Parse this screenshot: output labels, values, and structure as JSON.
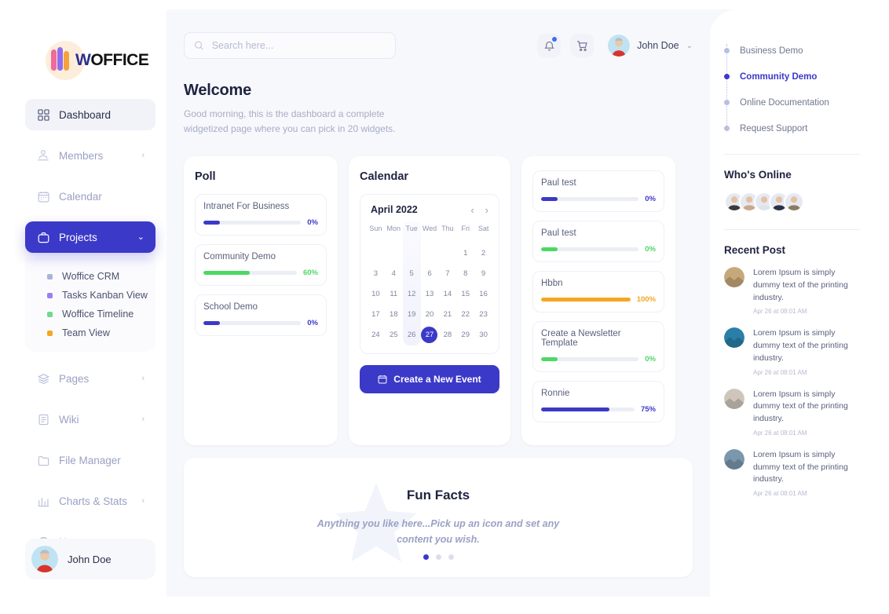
{
  "brand": {
    "name_part1": "W",
    "name_part2": "OFFICE"
  },
  "sidebar": {
    "items": [
      {
        "label": "Dashboard",
        "icon": "grid-icon",
        "state": "active-soft",
        "chevron": ""
      },
      {
        "label": "Members",
        "icon": "members-icon",
        "state": "",
        "chevron": "›"
      },
      {
        "label": "Calendar",
        "icon": "calendar-icon",
        "state": "",
        "chevron": ""
      },
      {
        "label": "Projects",
        "icon": "briefcase-icon",
        "state": "active-primary",
        "chevron": "⌄"
      }
    ],
    "submenu": [
      {
        "label": "Woffice CRM",
        "color": "#a8b4d8"
      },
      {
        "label": "Tasks Kanban View",
        "color": "#9b7ff0"
      },
      {
        "label": "Woffice Timeline",
        "color": "#72d88f"
      },
      {
        "label": "Team View",
        "color": "#f5a623"
      }
    ],
    "items_after": [
      {
        "label": "Pages",
        "icon": "layers-icon",
        "state": "",
        "chevron": "›"
      },
      {
        "label": "Wiki",
        "icon": "book-icon",
        "state": "",
        "chevron": "›"
      },
      {
        "label": "File Manager",
        "icon": "folder-icon",
        "state": "",
        "chevron": ""
      },
      {
        "label": "Charts & Stats",
        "icon": "chart-icon",
        "state": "",
        "chevron": "›"
      },
      {
        "label": "News",
        "icon": "globe-icon",
        "state": "",
        "chevron": ""
      }
    ],
    "user": {
      "name": "John Doe"
    }
  },
  "topbar": {
    "search_placeholder": "Search here...",
    "search_value": "",
    "notification_icon": "bell-icon",
    "cart_icon": "cart-icon",
    "user_name": "John Doe",
    "user_chevron": "⌄"
  },
  "welcome": {
    "title": "Welcome",
    "subtitle": "Good morning, this is the dashboard a complete widgetized page where you can pick in 20 widgets."
  },
  "poll": {
    "title": "Poll",
    "items": [
      {
        "label": "Intranet For Business",
        "percent": "0%",
        "fill": 17,
        "color": "#3b39c8"
      },
      {
        "label": "Community Demo",
        "percent": "60%",
        "fill": 50,
        "color": "#4bd964"
      },
      {
        "label": "School Demo",
        "percent": "0%",
        "fill": 17,
        "color": "#3b39c8"
      }
    ]
  },
  "calendar": {
    "title": "Calendar",
    "month": "April 2022",
    "prev_icon": "chevron-left-icon",
    "next_icon": "chevron-right-icon",
    "prev": "‹",
    "next": "›",
    "dow": [
      "Sun",
      "Mon",
      "Tue",
      "Wed",
      "Thu",
      "Fri",
      "Sat"
    ],
    "lead_blanks": 5,
    "days": [
      1,
      2,
      3,
      4,
      5,
      6,
      7,
      8,
      9,
      10,
      11,
      12,
      13,
      14,
      15,
      16,
      17,
      18,
      19,
      20,
      21,
      22,
      23,
      24,
      25,
      26,
      27,
      28,
      29,
      30
    ],
    "selected_day": 27,
    "highlight_column": "Tue",
    "button_label": "Create a New Event",
    "button_icon": "calendar-icon"
  },
  "tasks": {
    "items": [
      {
        "label": "Paul test",
        "percent": "0%",
        "fill": 17,
        "color": "#3b39c8"
      },
      {
        "label": "Paul test",
        "percent": "0%",
        "fill": 17,
        "color": "#4bd964"
      },
      {
        "label": "Hbbn",
        "percent": "100%",
        "fill": 100,
        "color": "#f5a623"
      },
      {
        "label": "Create a Newsletter Template",
        "percent": "0%",
        "fill": 17,
        "color": "#4bd964"
      },
      {
        "label": "Ronnie",
        "percent": "75%",
        "fill": 73,
        "color": "#3b39c8"
      }
    ]
  },
  "funfacts": {
    "title": "Fun Facts",
    "subtitle": "Anything you like here...Pick up an icon and set any content you wish.",
    "dots": [
      true,
      false,
      false
    ]
  },
  "rightpanel": {
    "demos": [
      {
        "label": "Business Demo",
        "active": false
      },
      {
        "label": "Community Demo",
        "active": true
      },
      {
        "label": "Online Documentation",
        "active": false
      },
      {
        "label": "Request Support",
        "active": false
      }
    ],
    "who_online_title": "Who's Online",
    "online_avatars": [
      "#3b3a35",
      "#c9a88b",
      "#dfe4ea",
      "#2b3245",
      "#8c7a62"
    ],
    "recent_post_title": "Recent Post",
    "posts": [
      {
        "text": "Lorem Ipsum is simply dummy text of the printing industry.",
        "time": "Apr 26 at 08:01 AM",
        "color": "#c6a87a"
      },
      {
        "text": "Lorem Ipsum is simply dummy text of the printing industry.",
        "time": "Apr 26 at 08:01 AM",
        "color": "#2a7fa8"
      },
      {
        "text": "Lorem Ipsum is simply dummy text of the printing industry.",
        "time": "Apr 26 at 08:01 AM",
        "color": "#cfc6bb"
      },
      {
        "text": "Lorem Ipsum is simply dummy text of the printing industry.",
        "time": "Apr 26 at 08:01 AM",
        "color": "#7a97ad"
      }
    ]
  },
  "colors": {
    "primary": "#3b39c8",
    "green": "#4bd964",
    "orange": "#f5a623",
    "bg": "#f7f8fc"
  }
}
